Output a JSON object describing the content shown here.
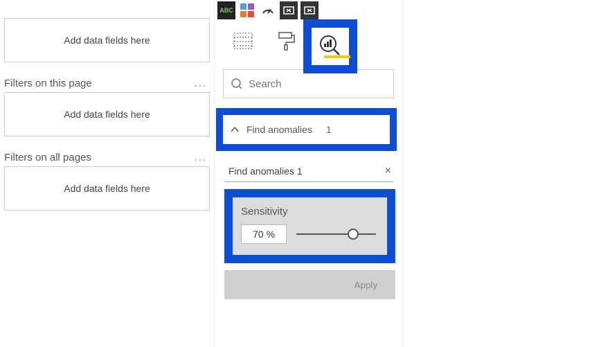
{
  "filters": {
    "dropzone_text": "Add data fields here",
    "page_section": "Filters on this page",
    "all_section": "Filters on all pages",
    "more": "..."
  },
  "viz": {
    "search_placeholder": "Search",
    "accordion": {
      "label": "Find anomalies",
      "count": "1"
    },
    "card": {
      "title": "Find anomalies 1",
      "close": "×"
    },
    "sensitivity": {
      "label": "Sensitivity",
      "value": "70",
      "unit": "%"
    },
    "apply": "Apply",
    "icons": {
      "abc": "ABC",
      "treemap": "treemap",
      "gauge": "gauge",
      "card_del1": "card-x",
      "card_del2": "card-x",
      "fields": "fields-tab",
      "format": "format-tab",
      "analytics": "analytics-tab"
    }
  }
}
